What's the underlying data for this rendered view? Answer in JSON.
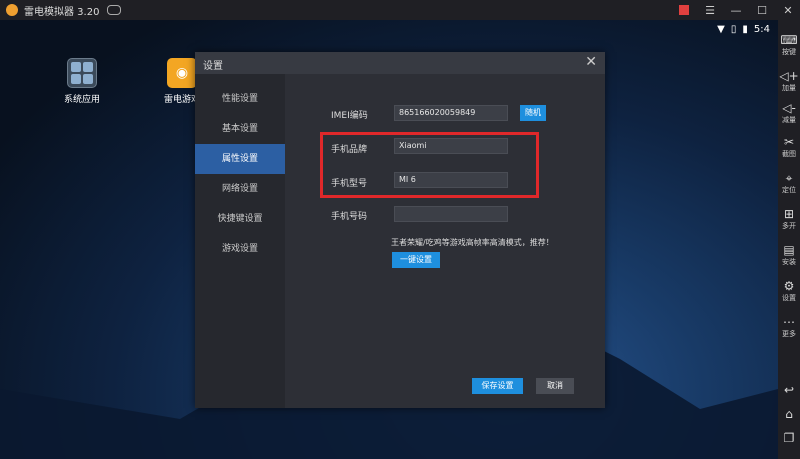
{
  "window": {
    "title": "雷电模拟器 3.20"
  },
  "status": {
    "time": "5:4"
  },
  "desktop": {
    "icons": [
      "系统应用",
      "雷电游戏"
    ]
  },
  "sidebar": {
    "items": [
      "按键",
      "加量",
      "减量",
      "截图",
      "定位",
      "多开",
      "安装",
      "设置",
      "更多"
    ]
  },
  "dialog": {
    "title": "设置",
    "nav": [
      "性能设置",
      "基本设置",
      "属性设置",
      "网络设置",
      "快捷键设置",
      "游戏设置"
    ],
    "active_nav": 2,
    "imei_label": "IMEI编码",
    "imei_value": "865166020059849",
    "random_label": "随机",
    "brand_label": "手机品牌",
    "brand_value": "Xiaomi",
    "model_label": "手机型号",
    "model_value": "MI 6",
    "phone_label": "手机号码",
    "phone_value": "",
    "hint": "王者荣耀/吃鸡等游戏高帧率高清模式，推荐！",
    "one_click_label": "一键设置",
    "save_label": "保存设置",
    "cancel_label": "取消"
  },
  "colors": {
    "accent": "#1e8fde",
    "nav_active": "#2c5fa3",
    "highlight": "#e0282a"
  }
}
